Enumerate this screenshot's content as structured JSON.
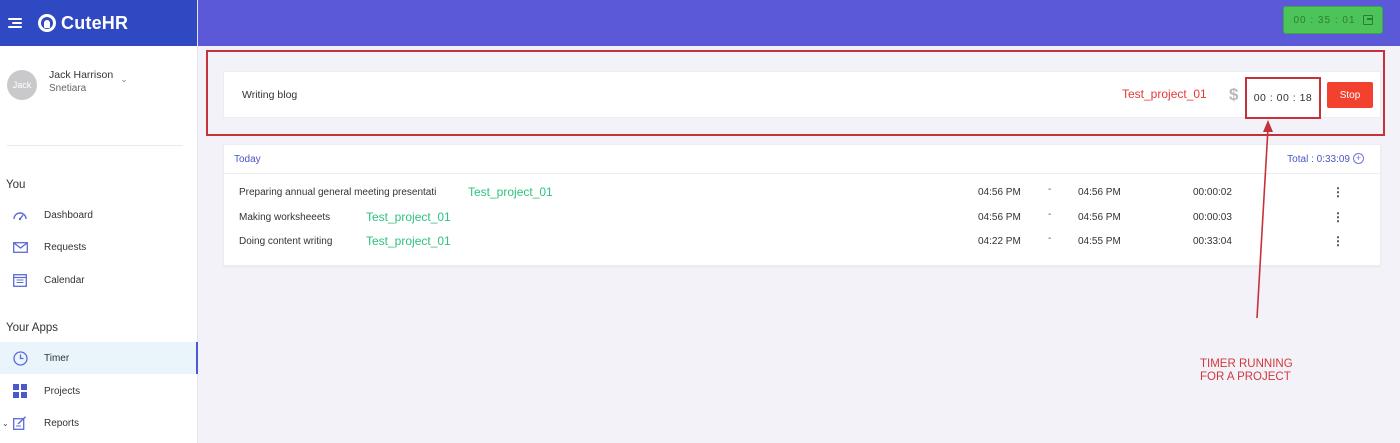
{
  "brand": {
    "name": "CuteHR"
  },
  "header": {
    "timer": "00 : 35 : 01"
  },
  "user": {
    "avatar": "Jack",
    "name": "Jack Harrison",
    "company": "Snetiara"
  },
  "sidebar": {
    "you_title": "You",
    "you_items": [
      {
        "label": "Dashboard",
        "icon": "dashboard-icon"
      },
      {
        "label": "Requests",
        "icon": "mail-icon"
      },
      {
        "label": "Calendar",
        "icon": "calendar-icon"
      }
    ],
    "apps_title": "Your Apps",
    "app_items": [
      {
        "label": "Timer",
        "icon": "clock-icon",
        "active": true
      },
      {
        "label": "Projects",
        "icon": "grid-icon"
      },
      {
        "label": "Reports",
        "icon": "report-icon"
      }
    ]
  },
  "active_timer": {
    "task": "Writing blog",
    "project": "Test_project_01",
    "time": "00 : 00 : 18",
    "stop_label": "Stop"
  },
  "today": {
    "label": "Today",
    "total": "Total : 0:33:09",
    "entries": [
      {
        "task": "Preparing annual general meeting presentati",
        "project": "Test_project_01",
        "start": "04:56 PM",
        "sep": "-",
        "end": "04:56 PM",
        "duration": "00:00:02"
      },
      {
        "task": "Making worksheeets",
        "project": "Test_project_01",
        "start": "04:56 PM",
        "sep": "-",
        "end": "04:56 PM",
        "duration": "00:00:03"
      },
      {
        "task": "Doing content writing",
        "project": "Test_project_01",
        "start": "04:22 PM",
        "sep": "-",
        "end": "04:55 PM",
        "duration": "00:33:04"
      }
    ]
  },
  "annotation": {
    "line1": "TIMER RUNNING",
    "line2": "FOR A PROJECT"
  },
  "colors": {
    "brand": "#2f49c3",
    "header": "#5c59d8",
    "stop": "#f2412f",
    "project_running": "#e53935",
    "project_done": "#2ec27e",
    "annotation": "#c6323a"
  }
}
